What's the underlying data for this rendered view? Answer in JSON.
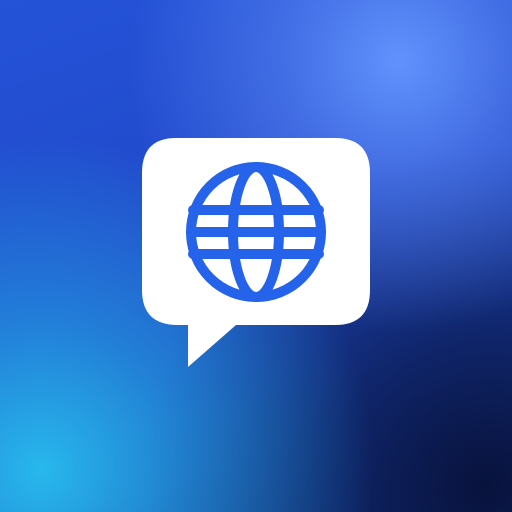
{
  "icon": {
    "name": "chat-globe-app-icon",
    "glyph": "globe-icon",
    "container": "speech-bubble",
    "colors": {
      "bubble": "#ffffff",
      "globe": "#2563eb",
      "background_top": "#5a8cf5",
      "background_mid": "#2148c8",
      "background_bottom_left": "#28bef0",
      "background_bottom_right": "#0c1a4a"
    }
  }
}
